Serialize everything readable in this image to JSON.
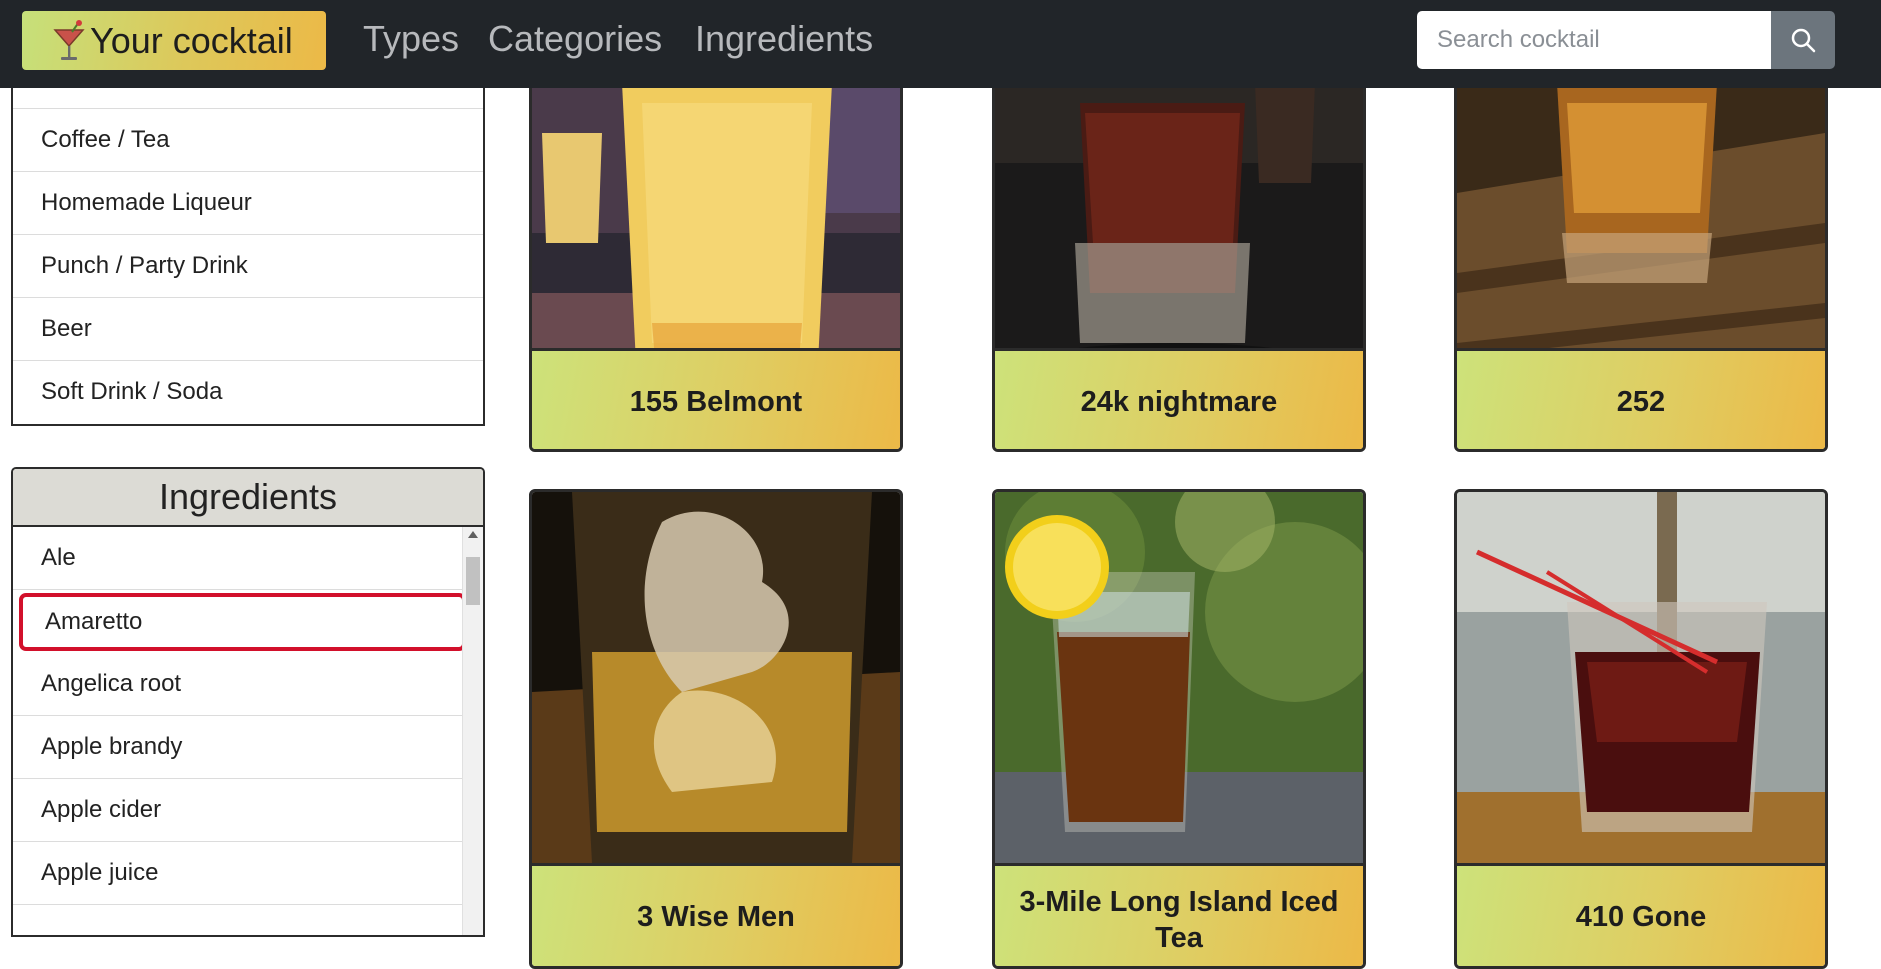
{
  "navbar": {
    "brand": "Your cocktail",
    "links": [
      "Types",
      "Categories",
      "Ingredients"
    ],
    "search_placeholder": "Search cocktail",
    "search_value": ""
  },
  "categories": {
    "items": [
      "Coffee / Tea",
      "Homemade Liqueur",
      "Punch / Party Drink",
      "Beer",
      "Soft Drink / Soda"
    ]
  },
  "ingredients": {
    "title": "Ingredients",
    "items": [
      "Ale",
      "Amaretto",
      "Angelica root",
      "Apple brandy",
      "Apple cider",
      "Apple juice"
    ],
    "selected": "Amaretto"
  },
  "cocktails": [
    {
      "name": "155 Belmont"
    },
    {
      "name": "24k nightmare"
    },
    {
      "name": "252"
    },
    {
      "name": "3 Wise Men"
    },
    {
      "name": "3-Mile Long Island Iced Tea"
    },
    {
      "name": "410 Gone"
    }
  ],
  "colors": {
    "navbar_bg": "#212529",
    "brand_gradient_start": "#c6e07a",
    "brand_gradient_end": "#ecb947",
    "selection_border": "#d2102b",
    "search_button_bg": "#6c757d"
  }
}
